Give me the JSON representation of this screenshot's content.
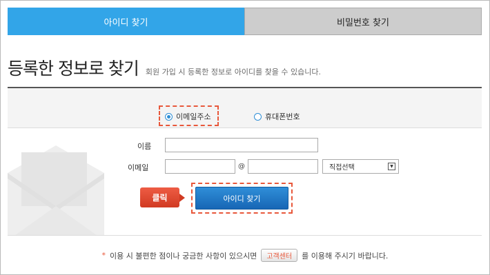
{
  "tabs": [
    {
      "label": "아이디 찾기",
      "active": true
    },
    {
      "label": "비밀번호 찾기",
      "active": false
    }
  ],
  "heading": {
    "title": "등록한 정보로 찾기",
    "subtitle": "회원 가입 시 등록한 정보로 아이디를 찾을 수 있습니다."
  },
  "radio_options": [
    {
      "label": "이메일주소",
      "checked": true
    },
    {
      "label": "휴대폰번호",
      "checked": false
    }
  ],
  "form": {
    "name_label": "이름",
    "email_label": "이메일",
    "name_value": "",
    "email_local_value": "",
    "email_domain_value": "",
    "at_symbol": "@",
    "domain_select": "직접선택",
    "domain_select_arrow": "▼"
  },
  "callout_label": "클릭",
  "submit_label": "아이디 찾기",
  "notice": {
    "star": "*",
    "before": "이용 시 불편한 점이나 궁금한 사항이 있으시면",
    "button_label": "고객센터",
    "after": "를 이용해 주시기 바랍니다."
  },
  "colors": {
    "tab_active": "#32a5e8",
    "tab_inactive": "#cdcdcd",
    "highlight_dashed": "#e8573a",
    "submit_button": "#1f78c8",
    "callout": "#d13a22"
  },
  "icons": {
    "background_illustration": "envelope-icon"
  }
}
